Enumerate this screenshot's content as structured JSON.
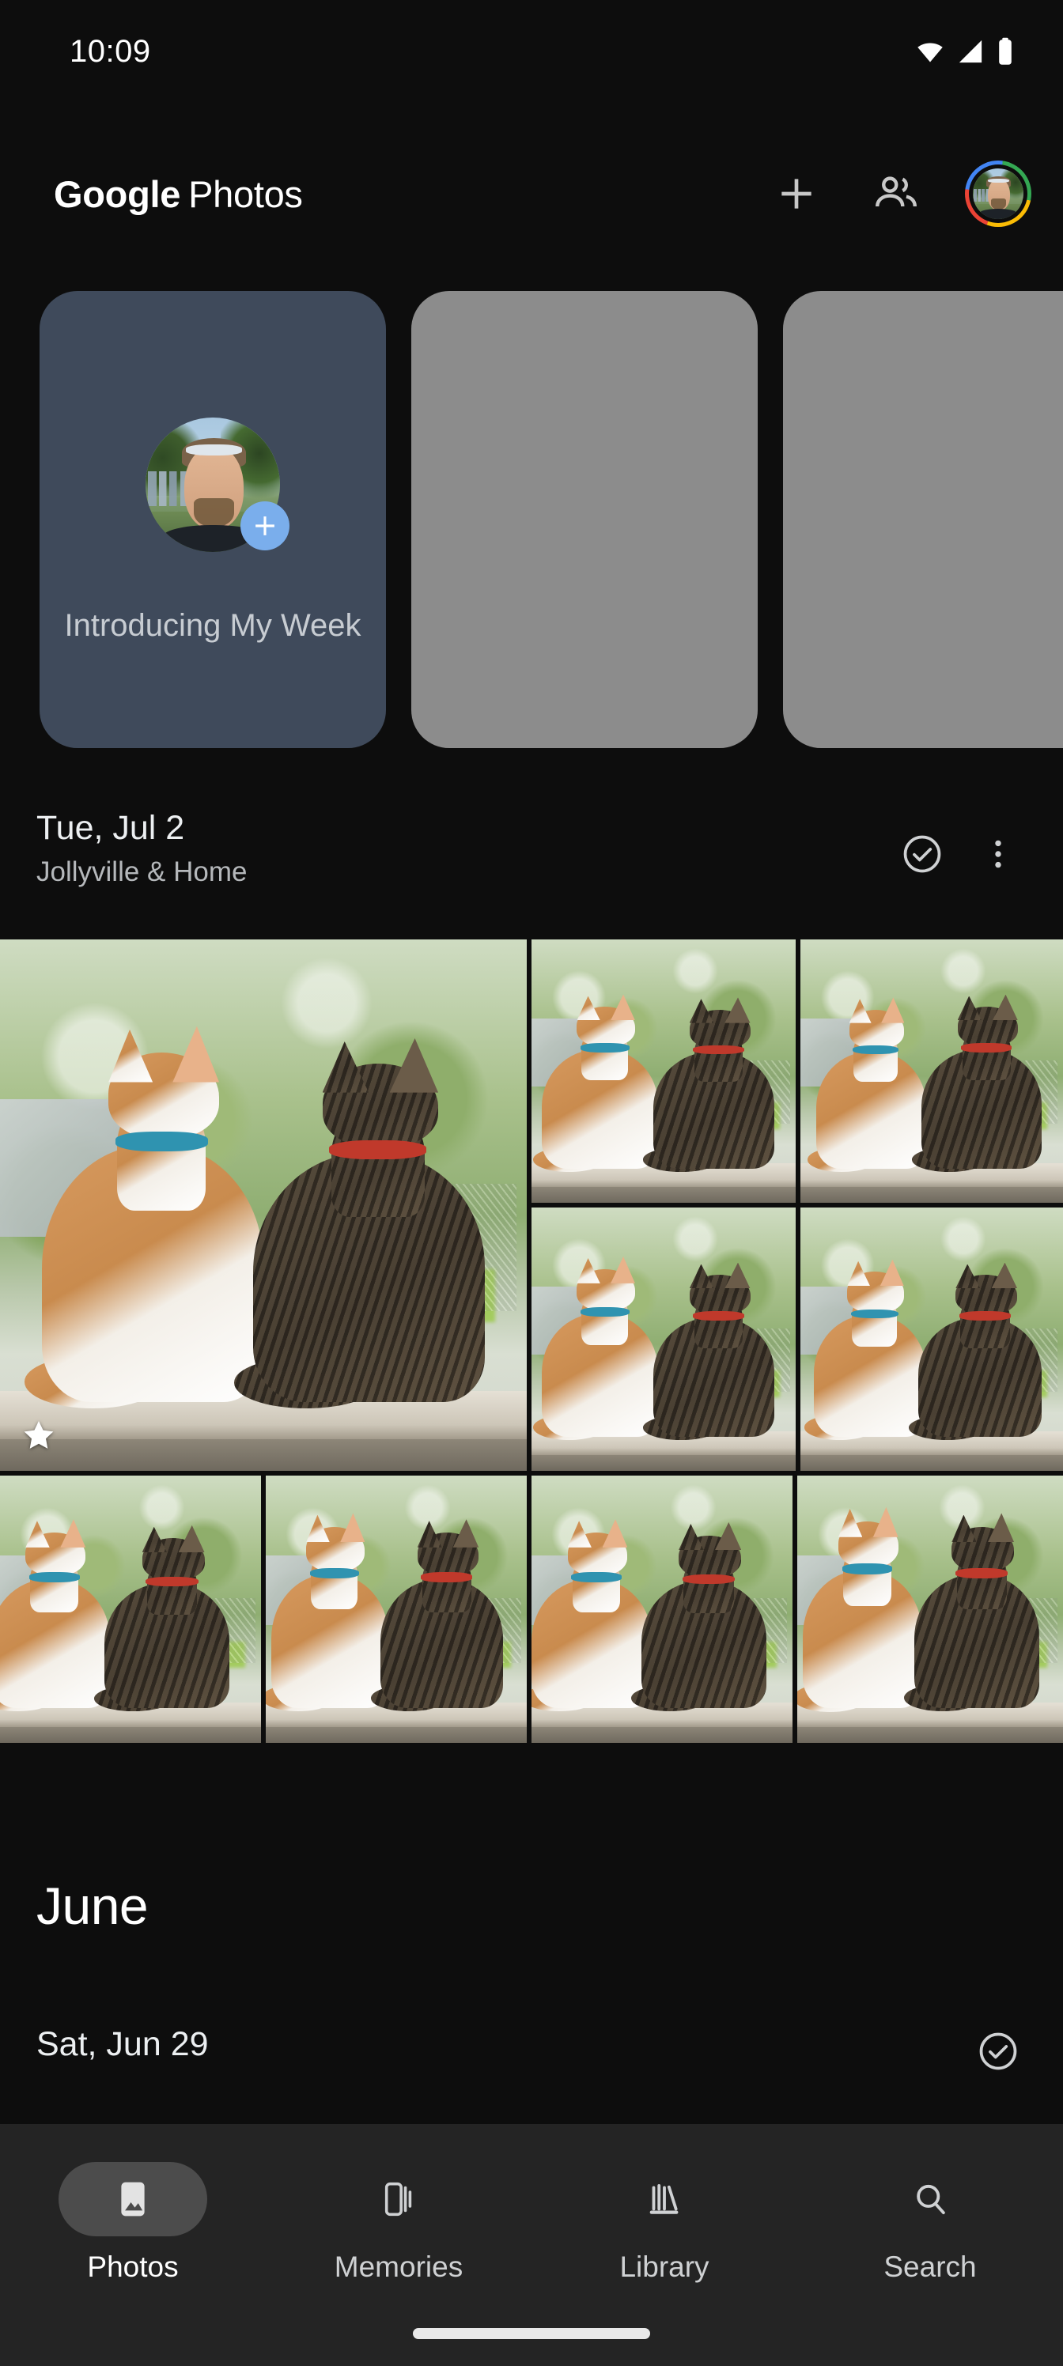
{
  "status_bar": {
    "time": "10:09",
    "icons": [
      "wifi-icon",
      "cellular-signal-icon",
      "battery-icon"
    ]
  },
  "header": {
    "title_brand": "Google",
    "title_product": "Photos",
    "add_label": "+",
    "icons": [
      "plus-icon",
      "sharing-people-icon",
      "account-avatar"
    ],
    "ring_colors": {
      "red": "#ea4335",
      "blue": "#4285f4",
      "green": "#34a853",
      "yellow": "#fbbc05"
    }
  },
  "memories": [
    {
      "id": "introducing-my-week",
      "title": "Introducing My Week",
      "type": "intro",
      "background": "#3f4a5b",
      "badge": "plus-icon",
      "badge_color": "#7aaeec"
    },
    {
      "id": "memory-placeholder-1",
      "title": "",
      "type": "placeholder",
      "background": "#8c8c8c"
    },
    {
      "id": "memory-placeholder-2",
      "title": "",
      "type": "placeholder",
      "background": "#8c8c8c"
    }
  ],
  "sections": [
    {
      "id": "section-jul-2",
      "date": "Tue, Jul 2",
      "location": "Jollyville & Home",
      "select_icon": "check-circle-icon",
      "overflow_icon": "more-vertical-icon",
      "photos": [
        {
          "id": "photo-1",
          "favorite": true,
          "alt": "two cats on windowsill",
          "badge": "star-icon"
        },
        {
          "id": "photo-2",
          "favorite": false,
          "alt": "two cats on windowsill"
        },
        {
          "id": "photo-3",
          "favorite": false,
          "alt": "two cats on windowsill"
        },
        {
          "id": "photo-4",
          "favorite": false,
          "alt": "two cats on windowsill"
        },
        {
          "id": "photo-5",
          "favorite": false,
          "alt": "two cats on windowsill"
        },
        {
          "id": "photo-6",
          "favorite": false,
          "alt": "two cats on windowsill"
        },
        {
          "id": "photo-7",
          "favorite": false,
          "alt": "two cats on windowsill"
        },
        {
          "id": "photo-8",
          "favorite": false,
          "alt": "two cats on windowsill"
        },
        {
          "id": "photo-9",
          "favorite": false,
          "alt": "two cats on windowsill"
        }
      ]
    }
  ],
  "month_header": {
    "label": "June"
  },
  "next_section": {
    "id": "section-jun-29",
    "date": "Sat, Jun 29",
    "select_icon": "check-circle-icon"
  },
  "bottom_nav": {
    "active": "Photos",
    "items": [
      {
        "label": "Photos",
        "icon": "photo-image-icon",
        "active": true
      },
      {
        "label": "Memories",
        "icon": "memories-cards-icon",
        "active": false
      },
      {
        "label": "Library",
        "icon": "library-books-icon",
        "active": false
      },
      {
        "label": "Search",
        "icon": "search-icon",
        "active": false
      }
    ]
  }
}
